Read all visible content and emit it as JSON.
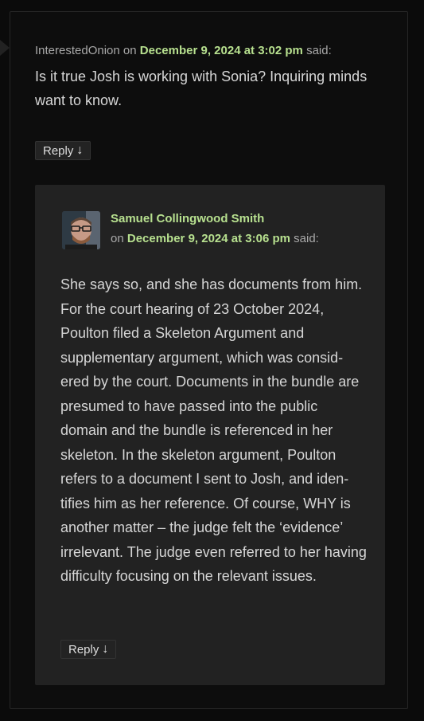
{
  "colors": {
    "background": "#0b0b0b",
    "outer_card": "#0d0d0d",
    "inner_card": "#222222",
    "accent_link": "#b7e08f",
    "body_text": "#d6d6d6",
    "muted_text": "#a9a9a9"
  },
  "comment": {
    "author": "InterestedOnion",
    "on_word": "on",
    "date": "December 9, 2024 at 3:02 pm",
    "said_word": "said:",
    "text": "Is it true Josh is working with Sonia? Inquiring minds want to know.",
    "reply_label": "Reply",
    "reply_icon": "↓"
  },
  "reply": {
    "avatar_icon": "user-avatar",
    "author": "Samuel Collingwood Smith",
    "on_word": "on",
    "date": "December 9, 2024 at 3:06 pm",
    "said_word": "said:",
    "text": "She says so, and she has documents from him. For the court hearing of 23 October 2024, Poulton filed a Skeleton Argument and supplementary argument, which was consid­ered by the court. Documents in the bundle are presumed to have passed into the public domain and the bundle is referenced in her skeleton. In the skeleton argument, Poulton refers to a document I sent to Josh, and iden­tifies him as her reference. Of course, WHY is another matter – the judge felt the ‘evi­dence’ irrelevant. The judge even referred to her having difficulty focusing on the relevant issues.",
    "reply_label": "Reply",
    "reply_icon": "↓"
  }
}
